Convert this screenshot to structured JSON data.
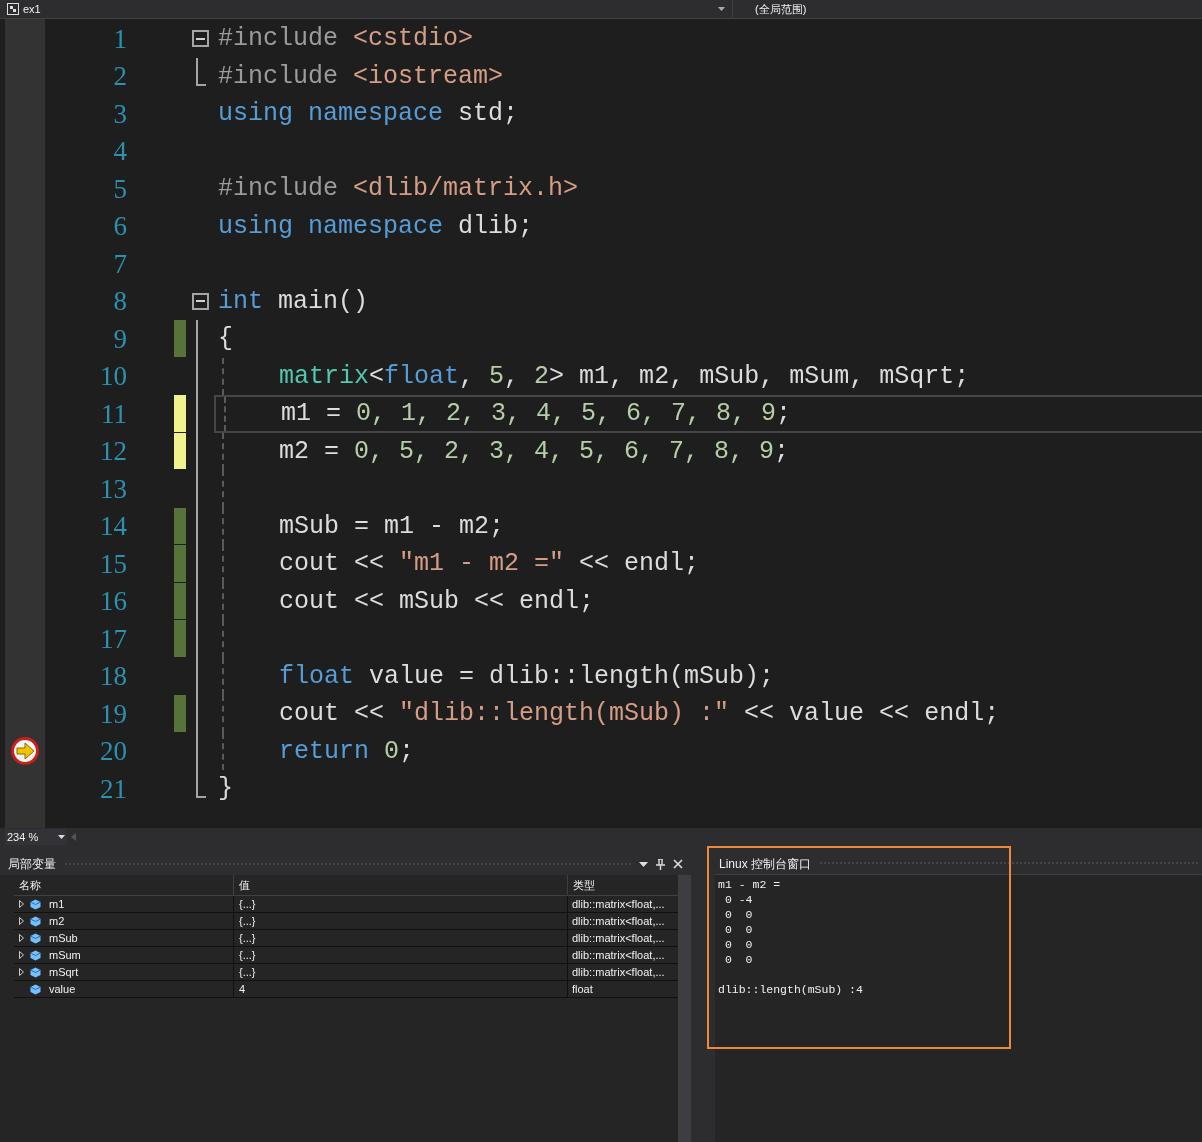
{
  "navigation_bar": {
    "project": "ex1",
    "scope": "(全局范围)"
  },
  "editor": {
    "lines": [
      {
        "number": "1",
        "collapsible": true,
        "tokens": [
          {
            "kind": "preproc",
            "text": "#include"
          },
          {
            "kind": "include",
            "text": " <cstdio>"
          }
        ]
      },
      {
        "number": "2",
        "fold_end": true,
        "tokens": [
          {
            "kind": "preproc",
            "text": "#include"
          },
          {
            "kind": "include",
            "text": " <iostream>"
          }
        ]
      },
      {
        "number": "3",
        "tokens": [
          {
            "kind": "keyword",
            "text": "using"
          },
          {
            "kind": "keyword",
            "text": " namespace"
          },
          {
            "kind": "ident",
            "text": " std;"
          }
        ]
      },
      {
        "number": "4"
      },
      {
        "number": "5",
        "tokens": [
          {
            "kind": "preproc",
            "text": "#include"
          },
          {
            "kind": "include",
            "text": " <dlib/matrix.h>"
          }
        ]
      },
      {
        "number": "6",
        "tokens": [
          {
            "kind": "keyword",
            "text": "using"
          },
          {
            "kind": "keyword",
            "text": " namespace"
          },
          {
            "kind": "ident",
            "text": " dlib;"
          }
        ]
      },
      {
        "number": "7"
      },
      {
        "number": "8",
        "collapsible": true,
        "tokens": [
          {
            "kind": "keyword",
            "text": "int"
          },
          {
            "kind": "ident",
            "text": " main()"
          }
        ]
      },
      {
        "number": "9",
        "in_fold": true,
        "color": "#57733a",
        "tokens": [
          {
            "kind": "ident",
            "text": "{"
          }
        ]
      },
      {
        "number": "10",
        "in_fold": true,
        "indented": true,
        "tokens": [
          {
            "kind": "type",
            "text": "matrix"
          },
          {
            "kind": "ident",
            "text": "<"
          },
          {
            "kind": "keyword",
            "text": "float"
          },
          {
            "kind": "ident",
            "text": ", "
          },
          {
            "kind": "number",
            "text": "5"
          },
          {
            "kind": "ident",
            "text": ", "
          },
          {
            "kind": "number",
            "text": "2"
          },
          {
            "kind": "ident",
            "text": "> m1, m2, mSub, mSum, mSqrt;"
          }
        ]
      },
      {
        "number": "11",
        "in_fold": true,
        "color": "#eff28d",
        "indented": true,
        "current": true,
        "tokens": [
          {
            "kind": "ident",
            "text": "m1 = "
          },
          {
            "kind": "number",
            "text": "0, 1, 2, 3, 4, 5, 6, 7, 8, 9"
          },
          {
            "kind": "ident",
            "text": ";"
          }
        ]
      },
      {
        "number": "12",
        "in_fold": true,
        "color": "#eff28d",
        "indented": true,
        "tokens": [
          {
            "kind": "ident",
            "text": "m2 = "
          },
          {
            "kind": "number",
            "text": "0, 5, 2, 3, 4, 5, 6, 7, 8, 9"
          },
          {
            "kind": "ident",
            "text": ";"
          }
        ]
      },
      {
        "number": "13",
        "in_fold": true,
        "indented": true
      },
      {
        "number": "14",
        "in_fold": true,
        "color": "#57733a",
        "indented": true,
        "tokens": [
          {
            "kind": "ident",
            "text": "mSub = m1 - m2;"
          }
        ]
      },
      {
        "number": "15",
        "in_fold": true,
        "color": "#57733a",
        "indented": true,
        "tokens": [
          {
            "kind": "ident",
            "text": "cout << "
          },
          {
            "kind": "string",
            "text": "\"m1 - m2 =\""
          },
          {
            "kind": "ident",
            "text": " << endl;"
          }
        ]
      },
      {
        "number": "16",
        "in_fold": true,
        "color": "#57733a",
        "indented": true,
        "tokens": [
          {
            "kind": "ident",
            "text": "cout << mSub << endl;"
          }
        ]
      },
      {
        "number": "17",
        "in_fold": true,
        "color": "#57733a",
        "indented": true
      },
      {
        "number": "18",
        "in_fold": true,
        "indented": true,
        "tokens": [
          {
            "kind": "keyword",
            "text": "float"
          },
          {
            "kind": "ident",
            "text": " value = dlib::length(mSub);"
          }
        ]
      },
      {
        "number": "19",
        "in_fold": true,
        "color": "#57733a",
        "indented": true,
        "tokens": [
          {
            "kind": "ident",
            "text": "cout << "
          },
          {
            "kind": "string",
            "text": "\"dlib::length(mSub) :\""
          },
          {
            "kind": "ident",
            "text": " << value << endl;"
          }
        ]
      },
      {
        "number": "20",
        "in_fold": true,
        "indented": true,
        "execution_point": true,
        "tokens": [
          {
            "kind": "keyword",
            "text": "return"
          },
          {
            "kind": "number",
            "text": " 0"
          },
          {
            "kind": "ident",
            "text": ";"
          }
        ]
      },
      {
        "number": "21",
        "fold_end": true,
        "tokens": [
          {
            "kind": "ident",
            "text": "}"
          }
        ]
      }
    ],
    "zoom": "234 %"
  },
  "locals": {
    "title": "局部变量",
    "columns": [
      "名称",
      "值",
      "类型"
    ],
    "rows": [
      {
        "expandable": true,
        "name": "m1",
        "value": "{...}",
        "type": "dlib::matrix<float,..."
      },
      {
        "expandable": true,
        "name": "m2",
        "value": "{...}",
        "type": "dlib::matrix<float,..."
      },
      {
        "expandable": true,
        "name": "mSub",
        "value": "{...}",
        "type": "dlib::matrix<float,..."
      },
      {
        "expandable": true,
        "name": "mSum",
        "value": "{...}",
        "type": "dlib::matrix<float,..."
      },
      {
        "expandable": true,
        "name": "mSqrt",
        "value": "{...}",
        "type": "dlib::matrix<float,..."
      },
      {
        "expandable": false,
        "name": "value",
        "value": "4",
        "type": "float"
      }
    ]
  },
  "console": {
    "title": "Linux 控制台窗口",
    "lines": [
      "m1 - m2 =",
      " 0 -4",
      " 0  0",
      " 0  0",
      " 0  0",
      " 0  0"
    ],
    "result": "dlib::length(mSub) :4"
  }
}
